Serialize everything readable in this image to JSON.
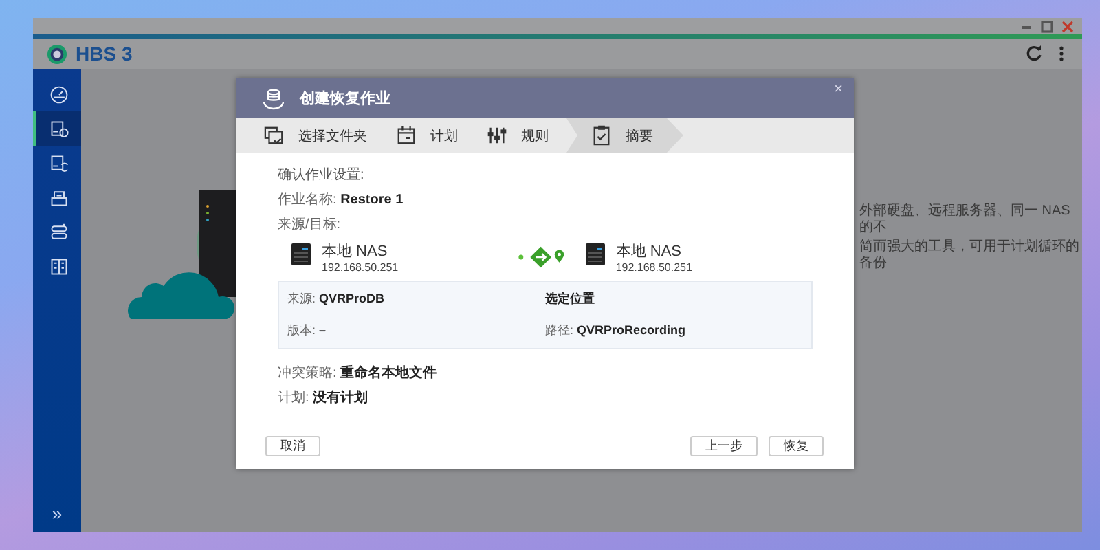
{
  "app": {
    "title": "HBS 3",
    "sidebar": [
      {
        "selected": false
      },
      {
        "selected": true
      },
      {
        "selected": false
      },
      {
        "selected": false
      },
      {
        "selected": false
      },
      {
        "selected": false
      }
    ],
    "expand": "»",
    "background_text": [
      "外部硬盘、远程服务器、同一 NAS 的不",
      "简而强大的工具，可用于计划循环的备份"
    ]
  },
  "dialog": {
    "title": "创建恢复作业",
    "close": "×",
    "steps": [
      {
        "label": "选择文件夹",
        "selected": false
      },
      {
        "label": "计划",
        "selected": false
      },
      {
        "label": "规则",
        "selected": false
      },
      {
        "label": "摘要",
        "selected": true
      }
    ],
    "heading": "确认作业设置:",
    "job_name": {
      "label": "作业名称:",
      "value": "Restore 1"
    },
    "endpoints_label": "来源/目标:",
    "source": {
      "name": "本地 NAS",
      "ip": "192.168.50.251"
    },
    "target": {
      "name": "本地 NAS",
      "ip": "192.168.50.251"
    },
    "details": [
      [
        {
          "label": "来源:",
          "value": "QVRProDB"
        },
        {
          "value": "选定位置"
        }
      ],
      [
        {
          "label": "版本:",
          "value": "–"
        },
        {
          "label": "路径:",
          "value": "QVRProRecording"
        }
      ]
    ],
    "conflict": {
      "label": "冲突策略:",
      "value": "重命名本地文件"
    },
    "schedule": {
      "label": "计划:",
      "value": "没有计划"
    },
    "cancel": "取消",
    "buttons": [
      "上一步",
      "恢复"
    ]
  }
}
